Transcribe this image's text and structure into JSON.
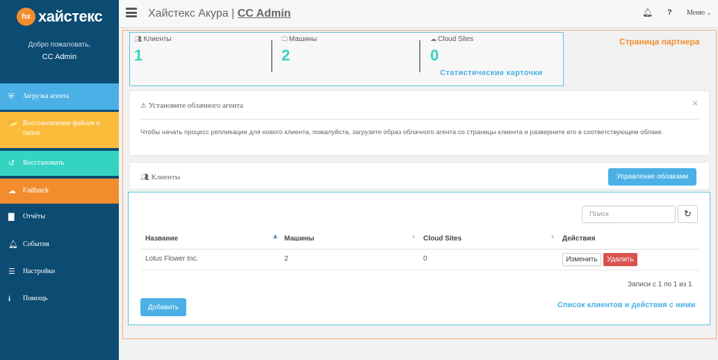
{
  "brand": {
    "badge": "hx",
    "name": "хайстекс"
  },
  "sidebar": {
    "welcome": "Добро пожаловать,",
    "user": "CC Admin",
    "items": [
      {
        "label": "Загрузка агента",
        "icon": "shield-icon",
        "color": "#4ab0e6"
      },
      {
        "label": "Восстановление файлов и папок",
        "icon": "folder-open-icon",
        "color": "#fbbc3c"
      },
      {
        "label": "Восстановить",
        "icon": "undo-icon",
        "color": "#35d3c2"
      },
      {
        "label": "Failback",
        "icon": "cloud-download-icon",
        "color": "#f28c2d"
      },
      {
        "label": "Отчёты",
        "icon": "bar-chart-icon"
      },
      {
        "label": "События",
        "icon": "bell-icon"
      },
      {
        "label": "Настройки",
        "icon": "sliders-icon"
      },
      {
        "label": "Помощь",
        "icon": "info-icon"
      }
    ]
  },
  "header": {
    "title": "Хайстекс Акура | ",
    "title_link": "CC Admin",
    "help": "?",
    "menu": "Меню"
  },
  "partner_label": "Страница партнера",
  "stats": {
    "caption": "Статистические карточки",
    "cards": [
      {
        "label": "Клиенты",
        "value": "1",
        "icon": "users-icon"
      },
      {
        "label": "Машины",
        "value": "2",
        "icon": "desktop-icon"
      },
      {
        "label": "Cloud Sites",
        "value": "0",
        "icon": "cloud-icon"
      }
    ]
  },
  "alert": {
    "title": "Установите облачного агента",
    "text": "Чтобы начать процесс репликации для нового клиента, пожалуйста, загрузите образ облачного агента со страницы клиента и разверните его в соответствующем облаке.",
    "close": "×"
  },
  "clients": {
    "title": "Клиенты",
    "manage_button": "Управление облаками",
    "search_placeholder": "Поиск",
    "columns": [
      "Название",
      "Машины",
      "Cloud Sites",
      "Действия"
    ],
    "rows": [
      {
        "name": "Lotus Flower Inc.",
        "machines": "2",
        "cloud_sites": "0"
      }
    ],
    "edit_label": "Изменить",
    "delete_label": "Удалить",
    "records": "Записи с 1 по 1 из 1",
    "add_button": "Добавить",
    "caption": "Список клиентов и действия с ними"
  }
}
